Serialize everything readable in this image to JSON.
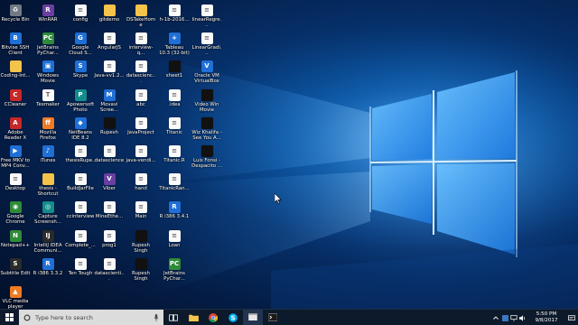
{
  "desktop": {
    "icons": [
      {
        "label": "Recycle Bin",
        "icon": "recycle-bin-icon",
        "cls": "gray",
        "glyph": "♻"
      },
      {
        "label": "Bitvise SSH Client",
        "icon": "bitvise-icon",
        "cls": "blue",
        "glyph": "B"
      },
      {
        "label": "Coding-Int...",
        "icon": "folder-icon",
        "cls": "folder",
        "glyph": ""
      },
      {
        "label": "CCleaner",
        "icon": "ccleaner-icon",
        "cls": "red",
        "glyph": "C"
      },
      {
        "label": "Adobe Reader X",
        "icon": "adobe-reader-icon",
        "cls": "red",
        "glyph": "A"
      },
      {
        "label": "Free MKV to MP4 Conv...",
        "icon": "converter-icon",
        "cls": "blue",
        "glyph": "▶"
      },
      {
        "label": "Desktop",
        "icon": "document-icon",
        "cls": "doc",
        "glyph": "≡"
      },
      {
        "label": "Google Chrome",
        "icon": "chrome-icon",
        "cls": "green",
        "glyph": "◉"
      },
      {
        "label": "Notepad++",
        "icon": "notepadpp-icon",
        "cls": "green",
        "glyph": "N"
      },
      {
        "label": "Subtitle Edit",
        "icon": "subtitle-edit-icon",
        "cls": "dark",
        "glyph": "S"
      },
      {
        "label": "VLC media player",
        "icon": "vlc-icon",
        "cls": "orange",
        "glyph": "▲"
      },
      {
        "label": "WinRAR",
        "icon": "winrar-icon",
        "cls": "purple",
        "glyph": "R"
      },
      {
        "label": "JetBrains PyChar...",
        "icon": "pycharm-icon",
        "cls": "green",
        "glyph": "PC"
      },
      {
        "label": "Windows Movie Maker",
        "icon": "movie-maker-icon",
        "cls": "blue",
        "glyph": "▣"
      },
      {
        "label": "Texmaker",
        "icon": "texmaker-icon",
        "cls": "doc",
        "glyph": "T"
      },
      {
        "label": "Mozilla Firefox",
        "icon": "firefox-icon",
        "cls": "orange",
        "glyph": "ff"
      },
      {
        "label": "iTunes",
        "icon": "itunes-icon",
        "cls": "blue",
        "glyph": "♪"
      },
      {
        "label": "thesis - Shortcut",
        "icon": "folder-icon",
        "cls": "folder",
        "glyph": ""
      },
      {
        "label": "Capture Screensh...",
        "icon": "capture-icon",
        "cls": "teal",
        "glyph": "◎"
      },
      {
        "label": "IntelliJ IDEA Communi...",
        "icon": "intellij-icon",
        "cls": "dark",
        "glyph": "IJ"
      },
      {
        "label": "R i386 3.3.2",
        "icon": "r-icon",
        "cls": "blue",
        "glyph": "R"
      },
      {
        "label": "config",
        "icon": "document-icon",
        "cls": "doc",
        "glyph": "≡"
      },
      {
        "label": "Google Cloud S...",
        "icon": "gcloud-icon",
        "cls": "blue",
        "glyph": "G"
      },
      {
        "label": "Skype",
        "icon": "skype-icon",
        "cls": "blue",
        "glyph": "S"
      },
      {
        "label": "Apowersoft Photo Viewer",
        "icon": "photo-viewer-icon",
        "cls": "teal",
        "glyph": "P"
      },
      {
        "label": "NetBeans IDE 8.2",
        "icon": "netbeans-icon",
        "cls": "blue",
        "glyph": "◆"
      },
      {
        "label": "thesisRupe...",
        "icon": "document-icon",
        "cls": "doc",
        "glyph": "≡"
      },
      {
        "label": "BuildJarFile",
        "icon": "document-icon",
        "cls": "doc",
        "glyph": "≡"
      },
      {
        "label": "ccinterview",
        "icon": "document-icon",
        "cls": "doc",
        "glyph": "≡"
      },
      {
        "label": "Complete_...",
        "icon": "document-icon",
        "cls": "doc",
        "glyph": "≡"
      },
      {
        "label": "Ten Tough",
        "icon": "document-icon",
        "cls": "doc",
        "glyph": "≡"
      },
      {
        "label": "gitdemo",
        "icon": "folder-icon",
        "cls": "folder",
        "glyph": ""
      },
      {
        "label": "AngularJS",
        "icon": "document-icon",
        "cls": "doc",
        "glyph": "≡"
      },
      {
        "label": "Java-vv1.2...",
        "icon": "document-icon",
        "cls": "doc",
        "glyph": "≡"
      },
      {
        "label": "Movavi Scree...",
        "icon": "movavi-icon",
        "cls": "blue",
        "glyph": "M"
      },
      {
        "label": "Rupesh",
        "icon": "video-file-icon",
        "cls": "black",
        "glyph": ""
      },
      {
        "label": "datascience",
        "icon": "document-icon",
        "cls": "doc",
        "glyph": "≡"
      },
      {
        "label": "Viber",
        "icon": "viber-icon",
        "cls": "purple",
        "glyph": "V"
      },
      {
        "label": "MineEthe...",
        "icon": "document-icon",
        "cls": "doc",
        "glyph": "≡"
      },
      {
        "label": "prog1",
        "icon": "document-icon",
        "cls": "doc",
        "glyph": "≡"
      },
      {
        "label": "datascienti...",
        "icon": "document-icon",
        "cls": "doc",
        "glyph": "≡"
      },
      {
        "label": "DSTakeHome",
        "icon": "folder-icon",
        "cls": "folder",
        "glyph": ""
      },
      {
        "label": "interview-q...",
        "icon": "document-icon",
        "cls": "doc",
        "glyph": "≡"
      },
      {
        "label": "datascienc...",
        "icon": "document-icon",
        "cls": "doc",
        "glyph": "≡"
      },
      {
        "label": "abc",
        "icon": "document-icon",
        "cls": "doc",
        "glyph": "≡"
      },
      {
        "label": "JavaProject",
        "icon": "document-icon",
        "cls": "doc",
        "glyph": "≡"
      },
      {
        "label": "java-vendi...",
        "icon": "document-icon",
        "cls": "doc",
        "glyph": "≡"
      },
      {
        "label": "hand",
        "icon": "document-icon",
        "cls": "doc",
        "glyph": "≡"
      },
      {
        "label": "Main",
        "icon": "document-icon",
        "cls": "doc",
        "glyph": "≡"
      },
      {
        "label": "Rupesh Singh",
        "icon": "video-file-icon",
        "cls": "black",
        "glyph": ""
      },
      {
        "label": "Rupesh Singh",
        "icon": "video-file-icon",
        "cls": "black",
        "glyph": ""
      },
      {
        "label": "h-1b-2016...",
        "icon": "document-icon",
        "cls": "doc",
        "glyph": "≡"
      },
      {
        "label": "Tableau 10.3 (32-bit)",
        "icon": "tableau-icon",
        "cls": "blue",
        "glyph": "+"
      },
      {
        "label": "sheet1",
        "icon": "video-file-icon",
        "cls": "black",
        "glyph": ""
      },
      {
        "label": ".idea",
        "icon": "document-icon",
        "cls": "doc",
        "glyph": "≡"
      },
      {
        "label": "Titanic",
        "icon": "document-icon",
        "cls": "doc",
        "glyph": "≡"
      },
      {
        "label": "Titanic.R",
        "icon": "document-icon",
        "cls": "doc",
        "glyph": "≡"
      },
      {
        "label": "TitanicRan...",
        "icon": "document-icon",
        "cls": "doc",
        "glyph": "≡"
      },
      {
        "label": "R i386 3.4.1",
        "icon": "r-icon",
        "cls": "blue",
        "glyph": "R"
      },
      {
        "label": "Loan",
        "icon": "document-icon",
        "cls": "doc",
        "glyph": "≡"
      },
      {
        "label": "JetBrains PyChar...",
        "icon": "pycharm-icon",
        "cls": "green",
        "glyph": "PC"
      },
      {
        "label": "linearRegre...",
        "icon": "document-icon",
        "cls": "doc",
        "glyph": "≡"
      },
      {
        "label": "LinearGradi...",
        "icon": "document-icon",
        "cls": "doc",
        "glyph": "≡"
      },
      {
        "label": "Oracle VM VirtualBox",
        "icon": "virtualbox-icon",
        "cls": "blue",
        "glyph": "V"
      },
      {
        "label": "Video Win Movie Maker",
        "icon": "video-file-icon",
        "cls": "black",
        "glyph": ""
      },
      {
        "label": "Wiz Khalifa - See You A...",
        "icon": "video-file-icon",
        "cls": "black",
        "glyph": ""
      },
      {
        "label": "Luis Fonsi - Despacito ...",
        "icon": "video-file-icon",
        "cls": "black",
        "glyph": ""
      }
    ]
  },
  "taskbar": {
    "search_placeholder": "Type here to search",
    "time": "5:50 PM",
    "date": "9/8/2017"
  },
  "colors": {
    "taskbar": "#0d1a2b",
    "search_bg": "#dcdcdc",
    "wallpaper_glow": "#2f8fe6"
  }
}
